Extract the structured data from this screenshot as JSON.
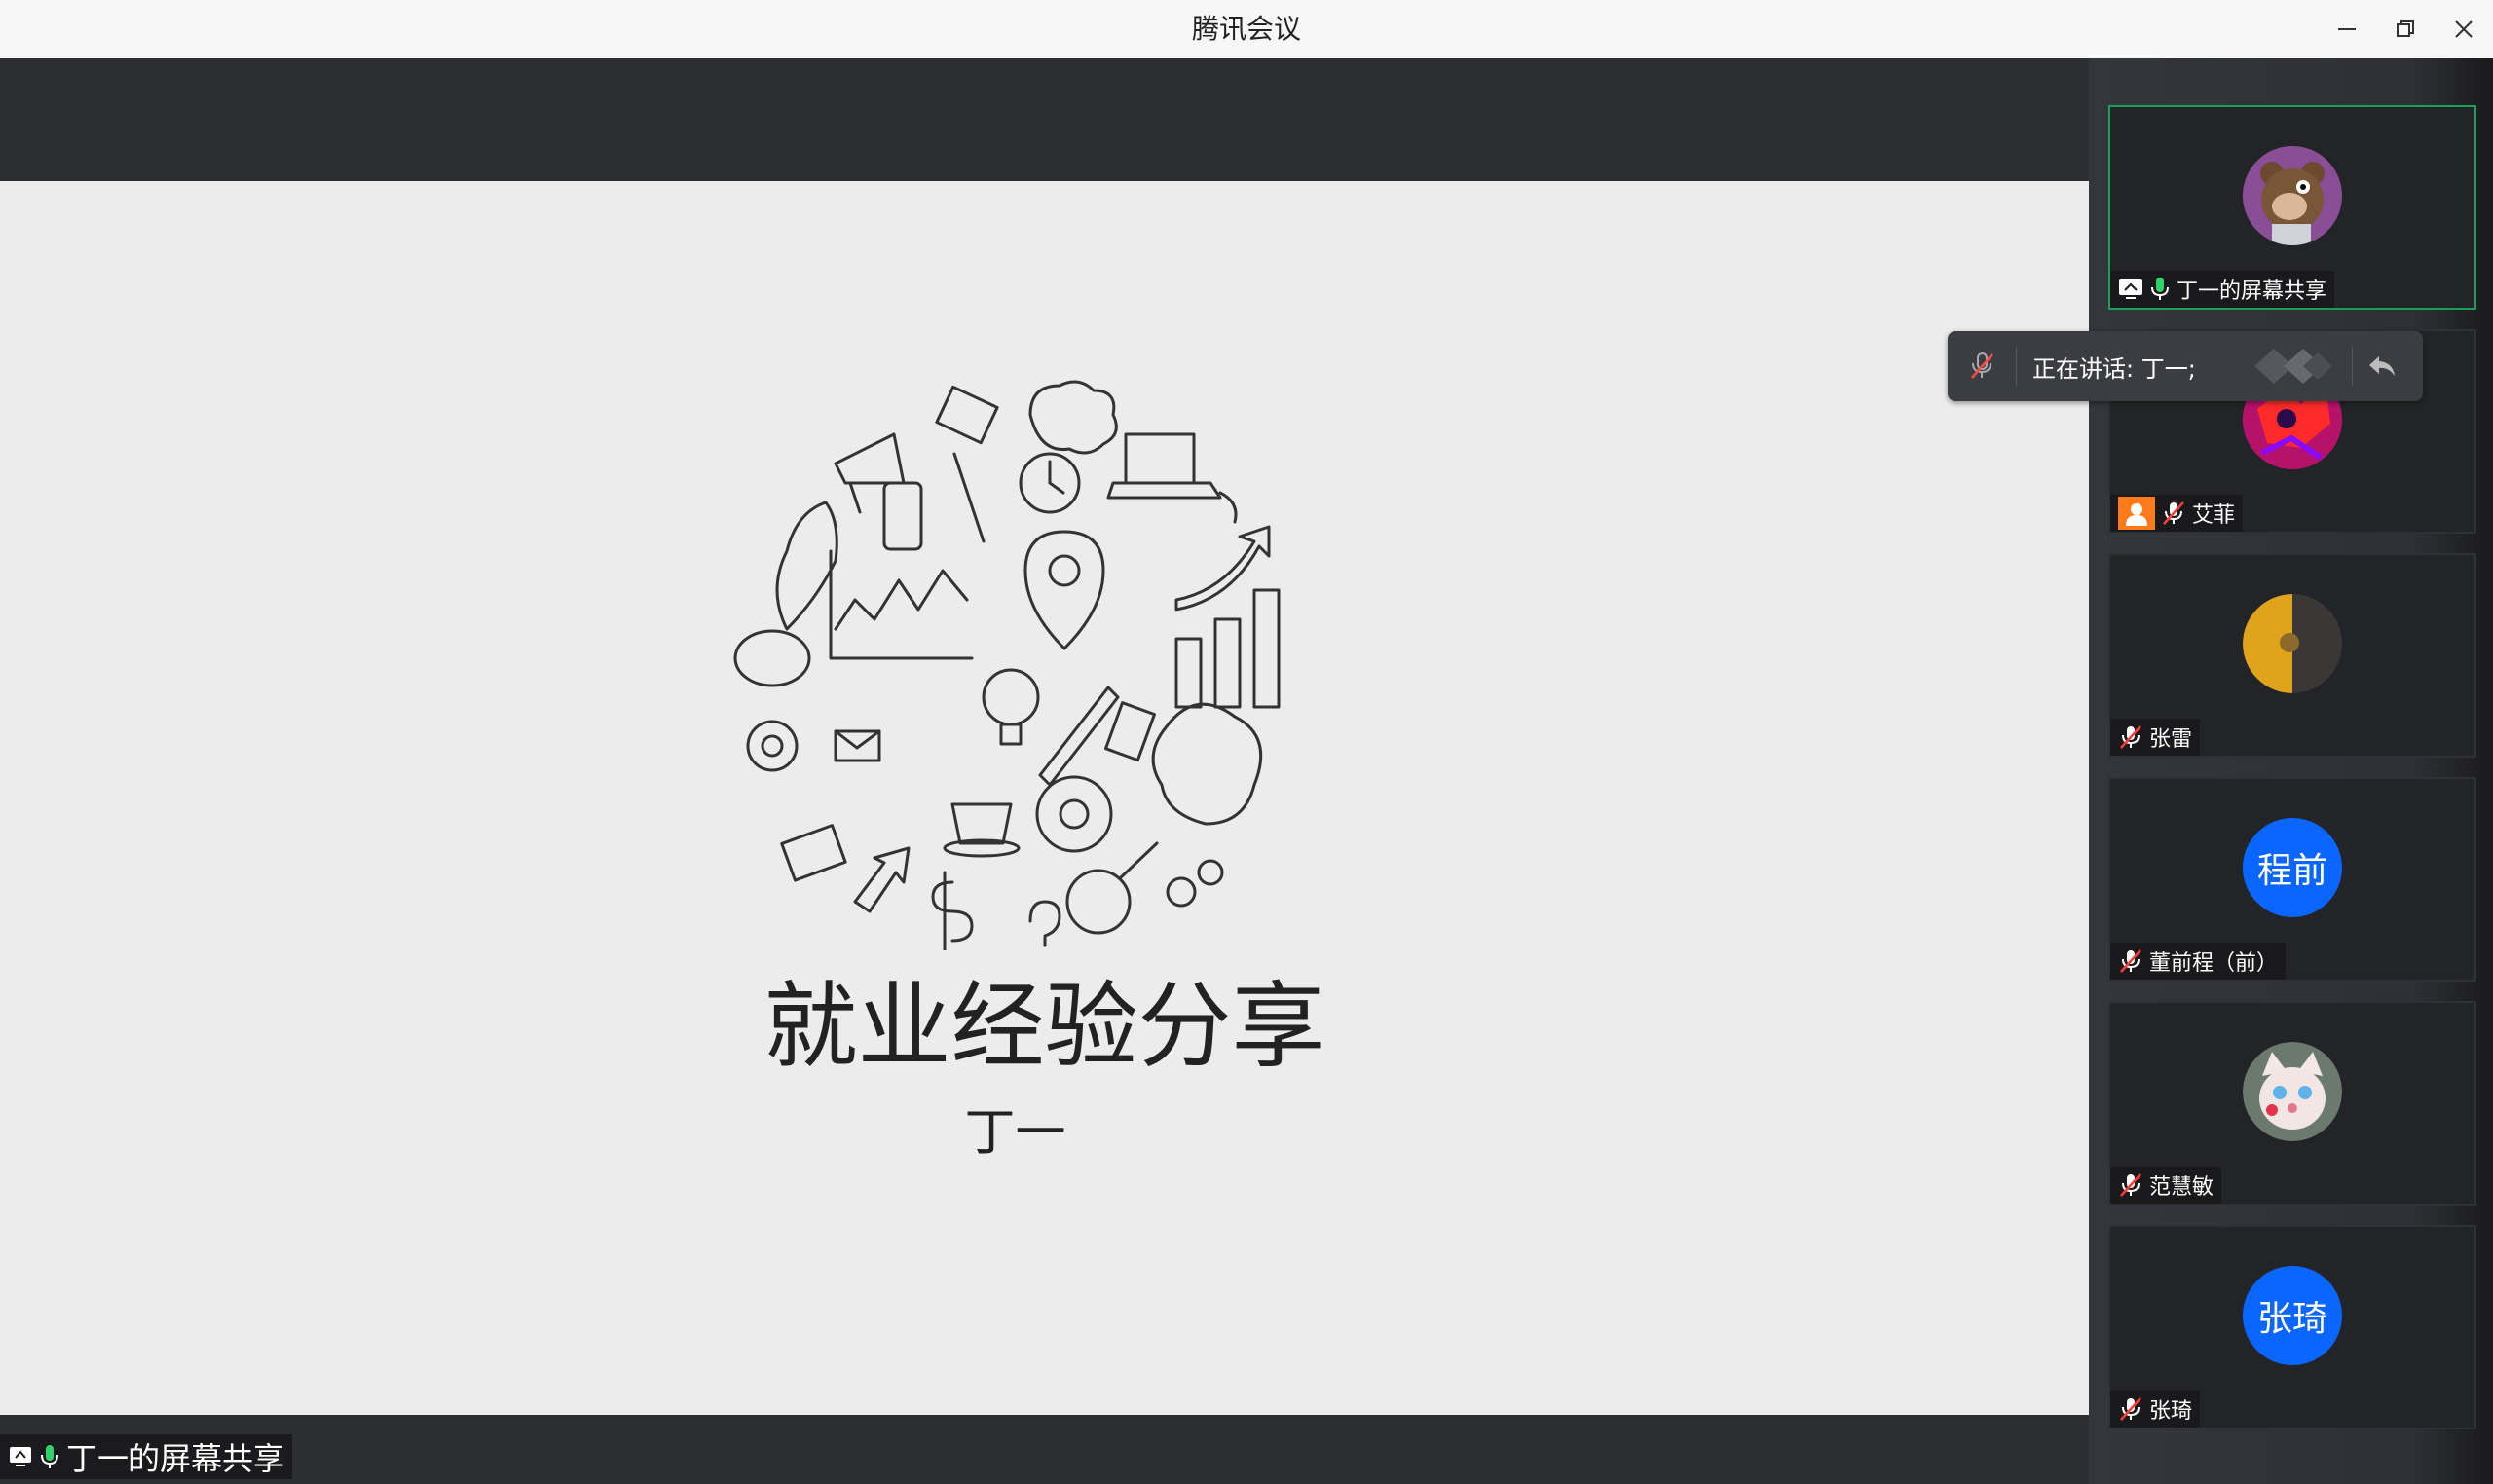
{
  "window": {
    "title": "腾讯会议"
  },
  "slide": {
    "title": "就业经验分享",
    "subtitle": "丁一"
  },
  "share_tag": {
    "label": "丁一的屏幕共享"
  },
  "speaking_banner": {
    "text": "正在讲话: 丁一;"
  },
  "participants": [
    {
      "name": "丁一的屏幕共享",
      "avatar": "bear-avatar",
      "active": true,
      "mic": "on",
      "sharing": true
    },
    {
      "name": "艾菲",
      "avatar": "colorful-avatar",
      "mic": "muted",
      "badge": "user-icon"
    },
    {
      "name": "张雷",
      "avatar": "moon-avatar",
      "mic": "muted"
    },
    {
      "name": "董前程（前）",
      "avatar_text": "程前",
      "mic": "muted"
    },
    {
      "name": "范慧敏",
      "avatar": "cat-avatar",
      "mic": "muted"
    },
    {
      "name": "张琦",
      "avatar_text": "张琦",
      "mic": "muted"
    }
  ],
  "colors": {
    "accent": "#1b9e5a",
    "avatar_blue": "#0a66ff",
    "orange_badge": "#ff7a1a"
  }
}
